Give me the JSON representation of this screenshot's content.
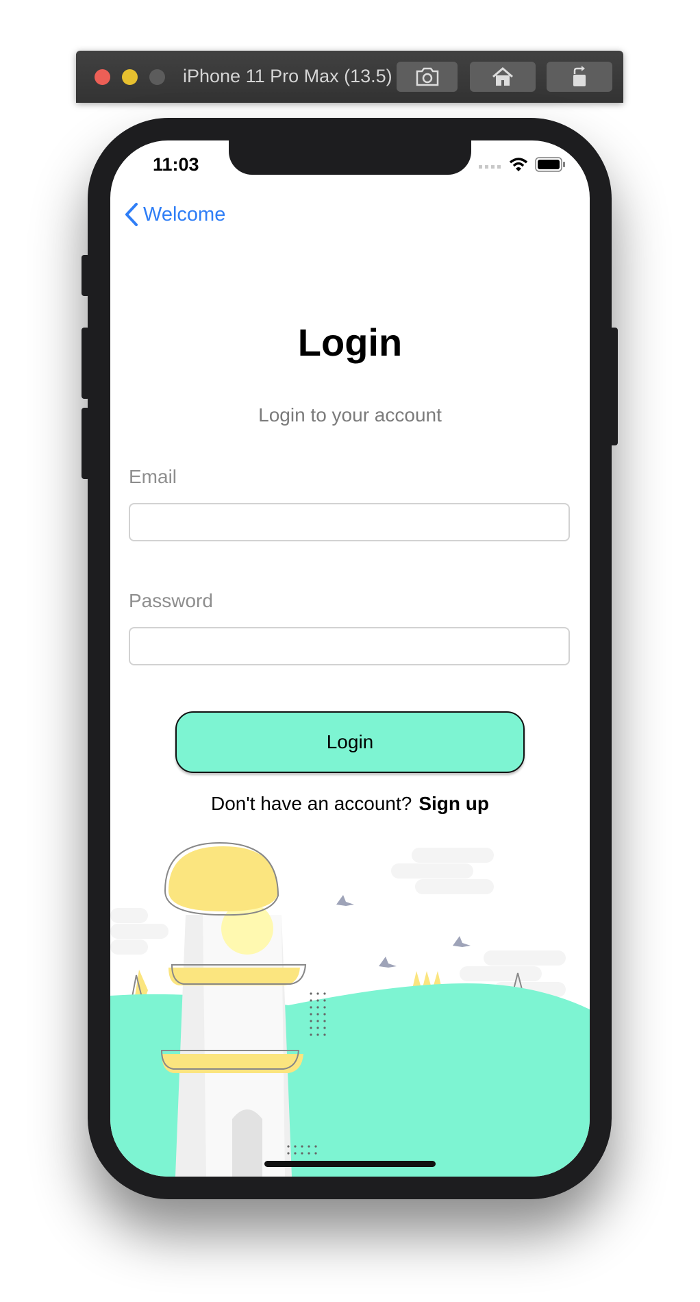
{
  "simulator": {
    "title": "iPhone 11 Pro Max (13.5)",
    "buttons": [
      "screenshot-icon",
      "home-icon",
      "rotate-icon"
    ]
  },
  "status_bar": {
    "time": "11:03",
    "icons": [
      "signal-icon",
      "wifi-icon",
      "battery-icon"
    ]
  },
  "nav": {
    "back_label": "Welcome"
  },
  "login": {
    "title": "Login",
    "subtitle": "Login to your account",
    "email_label": "Email",
    "email_value": "",
    "password_label": "Password",
    "password_value": "",
    "button_label": "Login",
    "no_account_text": "Don't have an account?",
    "signup_label": "Sign up"
  },
  "colors": {
    "accent": "#7df4d2",
    "link": "#2f7ef6",
    "illustration_yellow": "#fbe57f"
  }
}
